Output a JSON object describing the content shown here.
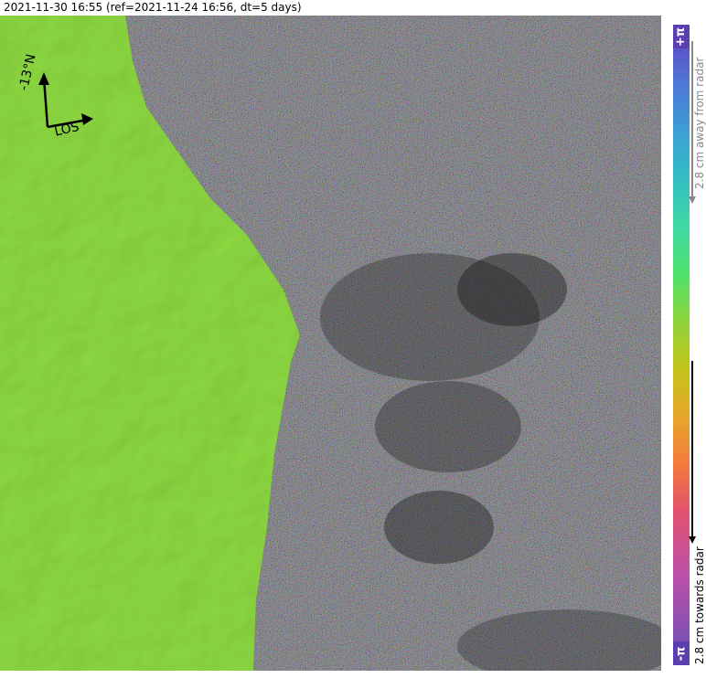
{
  "header": {
    "title": "2021-11-30 16:55 (ref=2021-11-24 16:56, dt=5 days)"
  },
  "map": {
    "north_arrow_label": "-13°N",
    "los_label": "LOS",
    "coherent_region_color": "#7fd43a",
    "interferogram_style": "decorrelated phase noise with shaded relief"
  },
  "colorbar": {
    "top_label": "+π",
    "bottom_label": "-π",
    "away_label": "2.8 cm away from radar",
    "towards_label": "2.8 cm towards radar",
    "colors": [
      "#5b55c9",
      "#3b9fd6",
      "#35bfc4",
      "#4fe26a",
      "#c4c31c",
      "#f47a3c",
      "#c050a8",
      "#7a4fb3"
    ]
  }
}
